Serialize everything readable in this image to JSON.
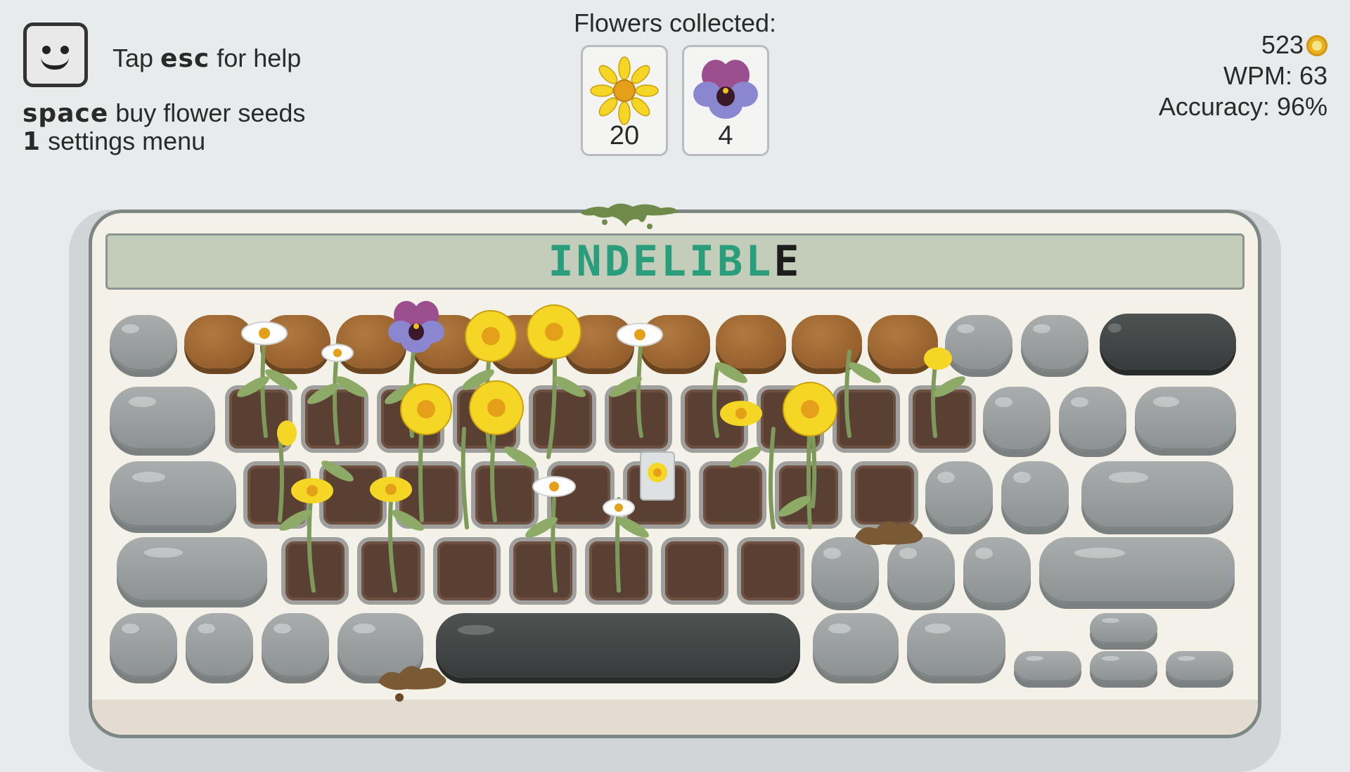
{
  "help": {
    "prefix": "Tap ",
    "key": "esc",
    "suffix": " for help",
    "shortcuts": [
      {
        "key": "space",
        "label": " buy flower seeds"
      },
      {
        "key": "1",
        "label": " settings menu"
      }
    ]
  },
  "collected": {
    "title": "Flowers collected:",
    "items": [
      {
        "icon": "sunflower-icon",
        "count": "20"
      },
      {
        "icon": "pansy-icon",
        "count": "4"
      }
    ]
  },
  "stats": {
    "coins": "523",
    "wpm": "WPM: 63",
    "accuracy": "Accuracy: 96%"
  },
  "display": {
    "typed": "INDELIBL",
    "next": "E"
  },
  "colors": {
    "typed": "#2a9d7d",
    "background": "#e8ebec",
    "soil": "#5a4032",
    "stone": "#9a9e9e"
  }
}
